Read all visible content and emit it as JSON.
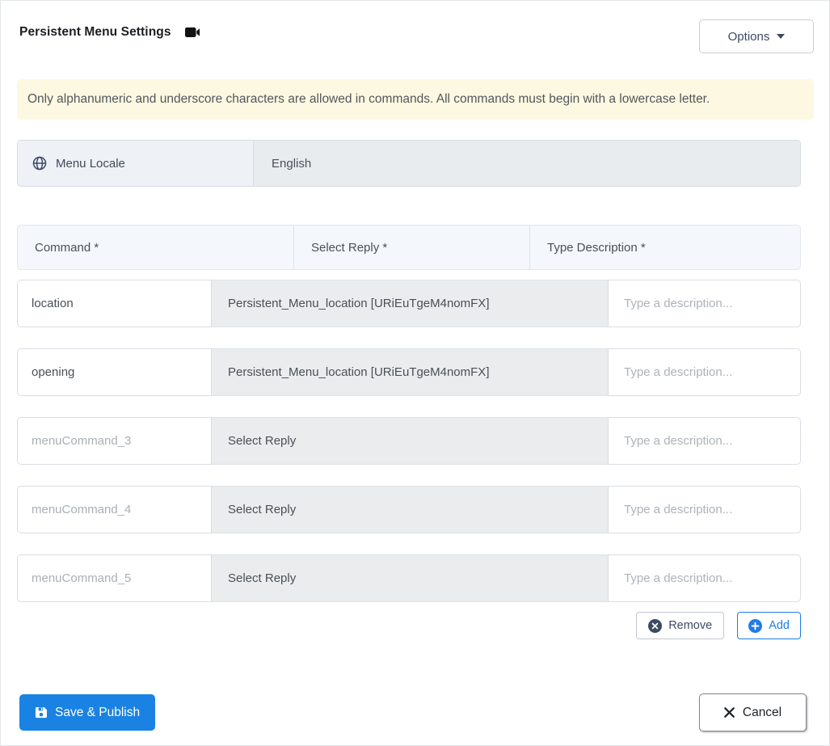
{
  "title": {
    "text": "Persistent Menu Settings"
  },
  "options_button": {
    "label": "Options"
  },
  "notice": {
    "text": "Only alphanumeric and underscore characters are allowed in commands. All commands must begin with a lowercase letter."
  },
  "locale": {
    "label": "Menu Locale",
    "value": "English"
  },
  "table": {
    "headers": {
      "command": "Command *",
      "reply": "Select Reply *",
      "description": "Type Description *"
    },
    "description_placeholder": "Type a description...",
    "rows": [
      {
        "command_value": "location",
        "reply": "Persistent_Menu_location [URiEuTgeM4nomFX]"
      },
      {
        "command_value": "opening",
        "reply": "Persistent_Menu_location [URiEuTgeM4nomFX]"
      },
      {
        "command_placeholder": "menuCommand_3",
        "reply": "Select Reply"
      },
      {
        "command_placeholder": "menuCommand_4",
        "reply": "Select Reply"
      },
      {
        "command_placeholder": "menuCommand_5",
        "reply": "Select Reply"
      }
    ]
  },
  "actions": {
    "remove_label": "Remove",
    "add_label": "Add"
  },
  "footer": {
    "save_label": "Save & Publish",
    "cancel_label": "Cancel"
  },
  "icons": {
    "title_icon": "videocam-icon",
    "options_caret": "caret-down-icon",
    "locale_icon": "globe-icon",
    "remove_icon": "x-circle-icon",
    "add_icon": "plus-circle-icon",
    "save_icon": "save-icon",
    "cancel_icon": "x-icon"
  },
  "colors": {
    "primary_blue": "#1a82e2",
    "accent_blue": "#1f7ce8",
    "dark_slate": "#3c4b64",
    "notice_bg": "#fdf8e1",
    "readonly_bg": "#e9ecef",
    "select_bg": "#ebeced",
    "header_bg": "#f4f8fc",
    "input_text": "#495057",
    "placeholder_text": "#a9b0b7"
  }
}
